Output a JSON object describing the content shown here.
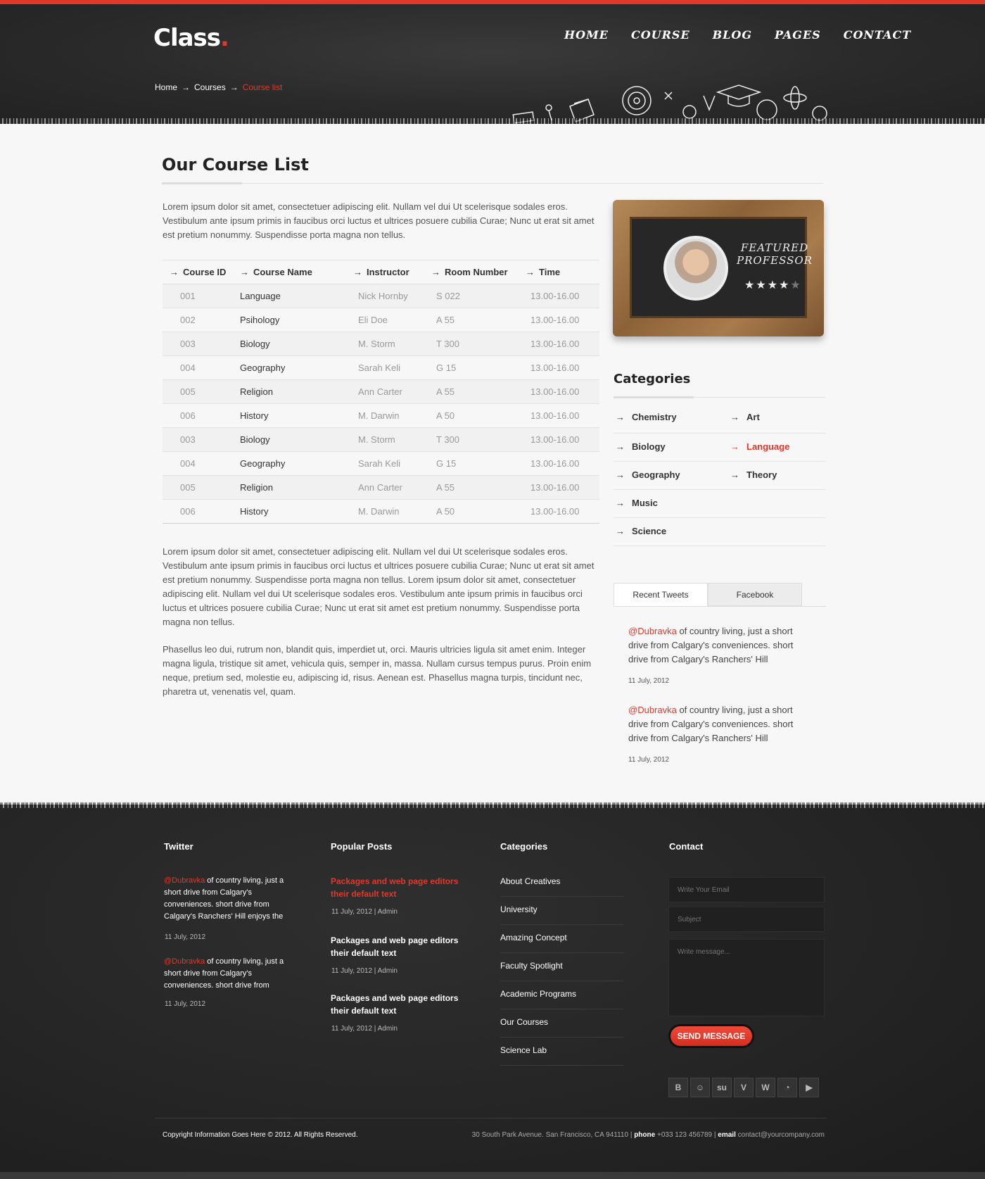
{
  "header": {
    "logo": "Class",
    "logo_dot": ".",
    "nav": [
      "HOME",
      "COURSE",
      "BLOG",
      "PAGES",
      "CONTACT"
    ],
    "breadcrumb": [
      "Home",
      "Courses",
      "Course list"
    ]
  },
  "main": {
    "title": "Our Course List",
    "intro": "Lorem ipsum dolor sit amet, consectetuer adipiscing elit. Nullam vel dui Ut scelerisque sodales eros. Vestibulum ante ipsum primis in faucibus orci luctus et ultrices posuere cubilia Curae; Nunc ut erat sit amet est pretium nonummy. Suspendisse porta magna non tellus.",
    "table": {
      "headers": [
        "Course ID",
        "Course Name",
        "Instructor",
        "Room Number",
        "Time"
      ],
      "rows": [
        [
          "001",
          "Language",
          "Nick Hornby",
          "S 022",
          "13.00-16.00"
        ],
        [
          "002",
          "Psihology",
          "Eli Doe",
          "A 55",
          "13.00-16.00"
        ],
        [
          "003",
          "Biology",
          "M. Storm",
          "T 300",
          "13.00-16.00"
        ],
        [
          "004",
          "Geography",
          "Sarah Keli",
          "G 15",
          "13.00-16.00"
        ],
        [
          "005",
          "Religion",
          "Ann Carter",
          "A 55",
          "13.00-16.00"
        ],
        [
          "006",
          "History",
          "M. Darwin",
          "A 50",
          "13.00-16.00"
        ],
        [
          "003",
          "Biology",
          "M. Storm",
          "T 300",
          "13.00-16.00"
        ],
        [
          "004",
          "Geography",
          "Sarah Keli",
          "G 15",
          "13.00-16.00"
        ],
        [
          "005",
          "Religion",
          "Ann Carter",
          "A 55",
          "13.00-16.00"
        ],
        [
          "006",
          "History",
          "M. Darwin",
          "A 50",
          "13.00-16.00"
        ]
      ]
    },
    "para1": "Lorem ipsum dolor sit amet, consectetuer adipiscing elit. Nullam vel dui Ut scelerisque sodales eros. Vestibulum ante ipsum primis in faucibus orci luctus et ultrices posuere cubilia Curae; Nunc ut erat sit amet est pretium nonummy. Suspendisse porta magna non tellus. Lorem ipsum dolor sit amet, consectetuer adipiscing elit. Nullam vel dui Ut scelerisque sodales eros. Vestibulum ante ipsum primis in faucibus orci luctus et ultrices posuere cubilia Curae; Nunc ut erat sit amet est pretium nonummy. Suspendisse porta magna non tellus.",
    "para2": "Phasellus leo dui, rutrum non, blandit quis, imperdiet ut, orci. Mauris ultricies ligula sit amet enim. Integer magna ligula, tristique sit amet, vehicula quis, semper in, massa. Nullam cursus tempus purus. Proin enim neque, pretium sed, molestie eu, adipiscing id, risus. Aenean est. Phasellus magna turpis, tincidunt nec, pharetra ut, venenatis vel, quam."
  },
  "sidebar": {
    "featured": {
      "line1": "FEATURED",
      "line2": "PROFESSOR",
      "rating": 4,
      "max_rating": 5
    },
    "categories_title": "Categories",
    "categories": [
      {
        "label": "Chemistry",
        "active": false
      },
      {
        "label": "Art",
        "active": false
      },
      {
        "label": "Biology",
        "active": false
      },
      {
        "label": "Language",
        "active": true
      },
      {
        "label": "Geography",
        "active": false
      },
      {
        "label": "Theory",
        "active": false
      },
      {
        "label": "Music",
        "active": false
      },
      {
        "label": "Science",
        "active": false
      }
    ],
    "tabs": [
      "Recent Tweets",
      "Facebook"
    ],
    "tweets": [
      {
        "handle": "@Dubravka",
        "text": " of country living, just a short drive from Calgary's conveniences. short drive from Calgary's Ranchers' Hill",
        "date": "11 July, 2012"
      },
      {
        "handle": "@Dubravka",
        "text": " of country living, just a short drive from Calgary's conveniences. short drive from Calgary's Ranchers' Hill",
        "date": "11 July, 2012"
      }
    ]
  },
  "footer": {
    "twitter_title": "Twitter",
    "tweets": [
      {
        "handle": "@Dubravka",
        "text": " of country living, just a short drive from Calgary's conveniences. short drive from Calgary's Ranchers' Hill enjoys the",
        "date": "11 July, 2012"
      },
      {
        "handle": "@Dubravka",
        "text": " of country living, just a short drive from Calgary's conveniences. short drive from",
        "date": "11 July, 2012"
      }
    ],
    "posts_title": "Popular Posts",
    "posts": [
      {
        "title": "Packages and web page editors their default text",
        "meta": "11 July, 2012 | Admin",
        "active": true
      },
      {
        "title": "Packages and web page editors their default text",
        "meta": "11 July, 2012 | Admin",
        "active": false
      },
      {
        "title": "Packages and web page editors their default text",
        "meta": "11 July, 2012 | Admin",
        "active": false
      }
    ],
    "categories_title": "Categories",
    "categories": [
      "About Creatives",
      "University",
      "Amazing Concept",
      "Faculty Spotlight",
      "Academic Programs",
      "Our Courses",
      "Science Lab"
    ],
    "contact_title": "Contact",
    "email_placeholder": "Write Your Email",
    "subject_placeholder": "Subject",
    "message_placeholder": "Write message...",
    "send_label": "SEND MESSAGE",
    "socials": [
      {
        "icon": "blogger-icon",
        "glyph": "B"
      },
      {
        "icon": "reddit-icon",
        "glyph": "☺"
      },
      {
        "icon": "stumbleupon-icon",
        "glyph": "su"
      },
      {
        "icon": "vimeo-icon",
        "glyph": "V"
      },
      {
        "icon": "wordpress-icon",
        "glyph": "W"
      },
      {
        "icon": "rss-icon",
        "glyph": "◔"
      },
      {
        "icon": "youtube-icon",
        "glyph": "▶"
      }
    ],
    "copyright": "Copyright Information Goes Here © 2012. All Rights Reserved.",
    "address": "30 South Park Avenue. San Francisco, CA 941110",
    "phone_label": "phone",
    "phone": "+033 123 456789",
    "email_label": "email",
    "email": "contact@yourcompany.com"
  },
  "colors": {
    "accent": "#e0392b",
    "dark": "#2a2a2a",
    "light": "#f7f7f7"
  }
}
